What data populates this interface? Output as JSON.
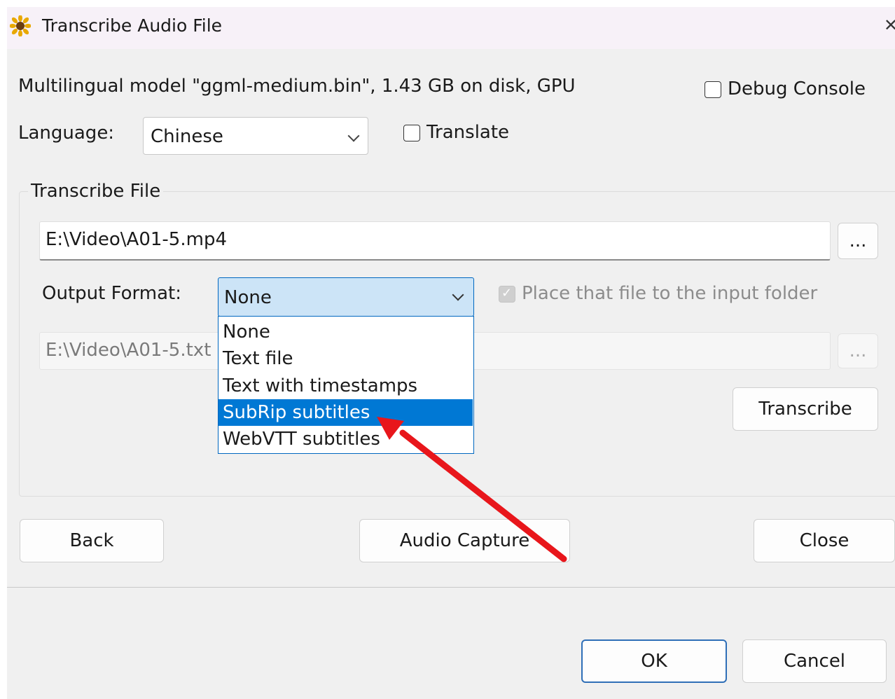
{
  "window": {
    "title": "Transcribe Audio File",
    "close_glyph": "✕"
  },
  "model_info": "Multilingual model \"ggml-medium.bin\", 1.43 GB on disk, GPU",
  "debug_console": {
    "label": "Debug Console",
    "checked": false
  },
  "language": {
    "label": "Language:",
    "value": "Chinese"
  },
  "translate": {
    "label": "Translate",
    "checked": false
  },
  "transcribe_file": {
    "group_title": "Transcribe File",
    "input_path": "E:\\Video\\A01-5.mp4",
    "browse_label": "...",
    "output_format_label": "Output Format:",
    "output_format_value": "None",
    "place_in_input_folder": {
      "label": "Place that file to the input folder",
      "checked": true,
      "enabled": false
    },
    "output_path": "E:\\Video\\A01-5.txt",
    "output_browse_label": "...",
    "transcribe_button": "Transcribe"
  },
  "dropdown": {
    "options": [
      "None",
      "Text file",
      "Text with timestamps",
      "SubRip subtitles",
      "WebVTT subtitles"
    ],
    "highlighted": "SubRip subtitles"
  },
  "buttons": {
    "back": "Back",
    "audio_capture": "Audio Capture",
    "close": "Close",
    "ok": "OK",
    "cancel": "Cancel"
  },
  "annotation": {
    "type": "arrow",
    "color": "#e8161b",
    "points_to": "SubRip subtitles"
  },
  "colors": {
    "accent": "#0078d4",
    "focus_fill": "#cce4f7",
    "arrow": "#e8161b"
  }
}
